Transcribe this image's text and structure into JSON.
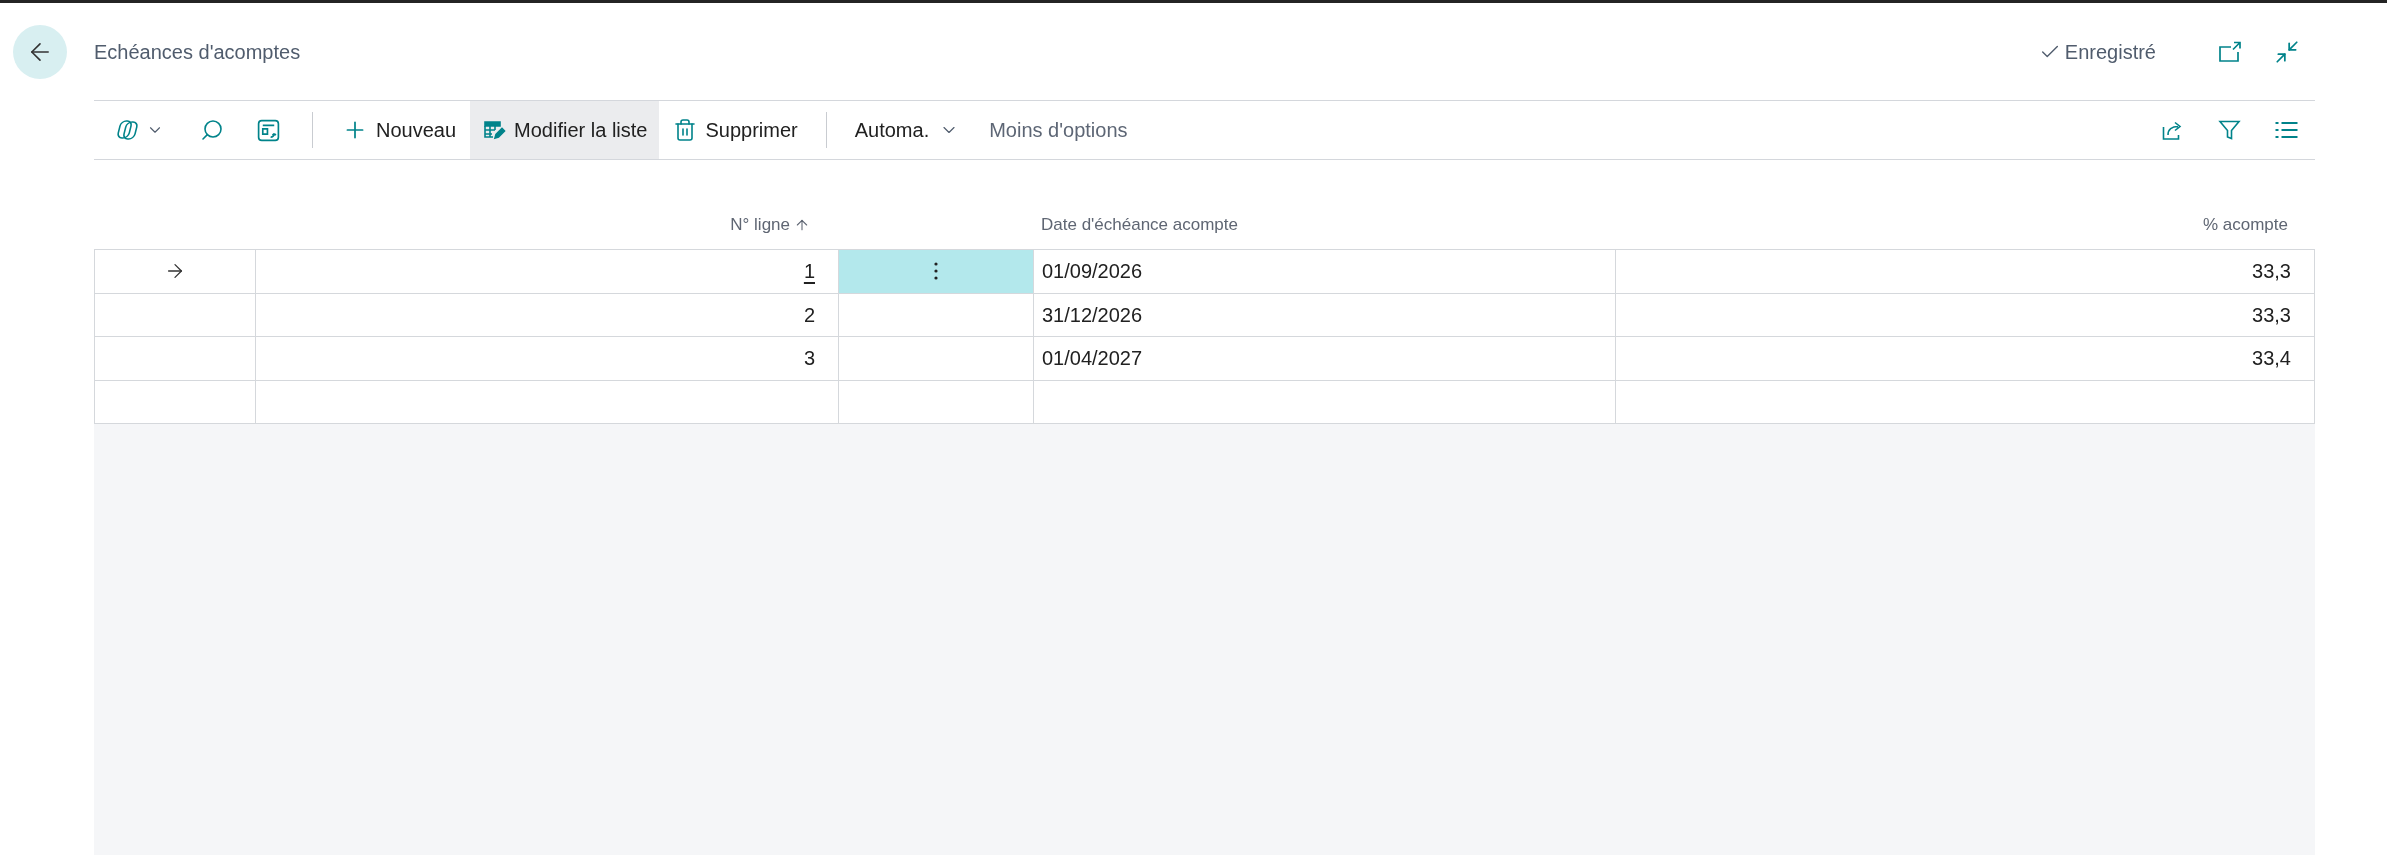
{
  "header": {
    "title": "Echéances d'acomptes",
    "status": "Enregistré"
  },
  "toolbar": {
    "actions": [
      {
        "label": "Nouveau",
        "selected": false
      },
      {
        "label": "Modifier la liste",
        "selected": true
      },
      {
        "label": "Supprimer",
        "selected": false
      }
    ],
    "menus": [
      {
        "label": "Automa."
      }
    ],
    "toggle": {
      "label": "Moins d'options"
    }
  },
  "table": {
    "columns": [
      {
        "label": "N° ligne",
        "sorted": true
      },
      {
        "label": "Date d'échéance acompte",
        "sorted": false
      },
      {
        "label": "% acompte",
        "sorted": false
      }
    ],
    "rows": [
      {
        "cells": [
          "1",
          "01/09/2026",
          "33,3"
        ],
        "selected": true
      },
      {
        "cells": [
          "2",
          "31/12/2026",
          "33,3"
        ],
        "selected": false
      },
      {
        "cells": [
          "3",
          "01/04/2027",
          "33,4"
        ],
        "selected": false
      }
    ]
  }
}
